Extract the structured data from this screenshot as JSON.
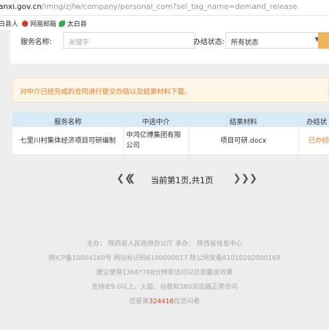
{
  "address_bar": {
    "host": "anxi.gov.cn",
    "path": "/imng/zjfw/company/personal_com?sel_tag_name=demand_release"
  },
  "bookmarks": [
    {
      "label": "白县人",
      "icon": "favicon-icon"
    },
    {
      "label": "网易邮箱",
      "icon": "netease-mail-icon"
    },
    {
      "label": "太白县",
      "icon": "leaf-favicon-icon"
    }
  ],
  "filters": {
    "service_name_label": "服务名称:",
    "keyword_placeholder": "关键字",
    "status_label": "办结状态:",
    "status_value": "所有状态",
    "dropdown_icon": "chevron-down-icon"
  },
  "notice": "对中介已经完成的合同进行提交办结以及结果材料下载。",
  "table": {
    "headers": [
      "服务名称",
      "中选中介",
      "结果材料",
      "办结状"
    ],
    "rows": [
      {
        "service": "七里川村集体经济项目可研编制",
        "agency_line1": "中鸿亿博集团有限",
        "agency_line2": "公司",
        "material": "项目可研.docx",
        "status": "已办结"
      }
    ]
  },
  "pagination": {
    "first_icon": "double-left-arrow-icon",
    "prev_icon": "left-arrow-icon",
    "next_icon": "right-arrow-icon",
    "last_icon": "double-right-arrow-icon",
    "text": "当前第1页,共1页"
  },
  "footer": {
    "line1": "主办：  陕西省人民政府办公厅   承办：  陕西省信息中心",
    "line2": "陕ICP备10004160号   网站标识码6100000017   陕公网安备61010202000169",
    "line3": "建议使用1366*768分辨率访问以达到最佳效果",
    "line4": "支持IE9.0以上、火狐、谷歌和360浏览器正常访问",
    "visitor_prefix": "您是第",
    "visitor_count": "324416",
    "visitor_suffix": "位访问者"
  },
  "colors": {
    "accent_button": "#f0b35a",
    "notice_text": "#e07b2a",
    "table_header": "#d6e9f7",
    "visitor_count": "#d9411e"
  }
}
